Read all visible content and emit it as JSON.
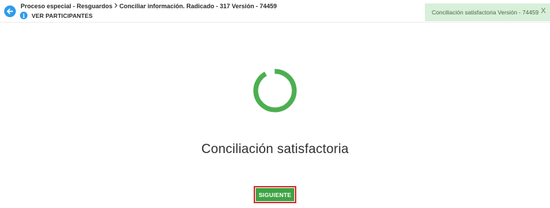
{
  "header": {
    "breadcrumb": [
      {
        "label": "Proceso especial - Resguardos"
      },
      {
        "label": "Conciliar información. Radicado - 317 Versión - 74459"
      }
    ],
    "participants_label": "VER PARTICIPANTES"
  },
  "toast": {
    "message": "Conciliación satisfactoria Versión - 74459",
    "close_label": "X"
  },
  "main": {
    "title": "Conciliación satisfactoria",
    "next_button_label": "SIGUIENTE"
  },
  "colors": {
    "accent_blue": "#2f9bea",
    "success_green": "#3fa343",
    "spinner_green": "#4caf50",
    "toast_bg": "#d8efd9",
    "highlight_red": "#d32f2f"
  }
}
